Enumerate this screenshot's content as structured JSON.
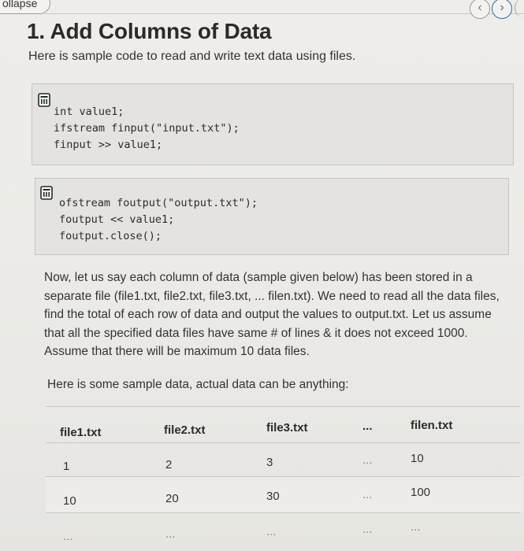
{
  "nav": {
    "collapse_label": "ollapse",
    "prev_glyph": "‹",
    "next_glyph": "›"
  },
  "question": {
    "title": "1. Add Columns of Data",
    "intro": "Here is sample code to read and write text data using files.",
    "code_blocks": [
      {
        "icon": "document-icon",
        "lines": [
          "int value1;",
          "ifstream finput(\"input.txt\");",
          "finput >> value1;"
        ]
      },
      {
        "icon": "document-icon",
        "lines": [
          "ofstream foutput(\"output.txt\");",
          "foutput << value1;",
          "foutput.close();"
        ]
      }
    ],
    "paragraph_lines": [
      "Now, let us say each column of data (sample given below) has been stored in a",
      "separate file (file1.txt, file2.txt, file3.txt, ... filen.txt). We need to read all the data files,",
      "find the total of each row of data and output the values to output.txt. Let us assume",
      "that all the specified data files have same # of lines & it does not exceed 1000.",
      "Assume that there will be maximum 10 data files."
    ],
    "sample_label": "Here is some sample data, actual data can be anything:"
  },
  "table": {
    "headers": [
      "file1.txt",
      "file2.txt",
      "file3.txt",
      "...",
      "filen.txt"
    ],
    "rows": [
      [
        "1",
        "2",
        "3",
        "...",
        "10"
      ],
      [
        "10",
        "20",
        "30",
        "...",
        "100"
      ],
      [
        "...",
        "...",
        "...",
        "...",
        "..."
      ]
    ]
  },
  "colors": {
    "accent": "#2f6fb2",
    "background": "#ecebe8",
    "code_background": "#e4e3e0"
  }
}
